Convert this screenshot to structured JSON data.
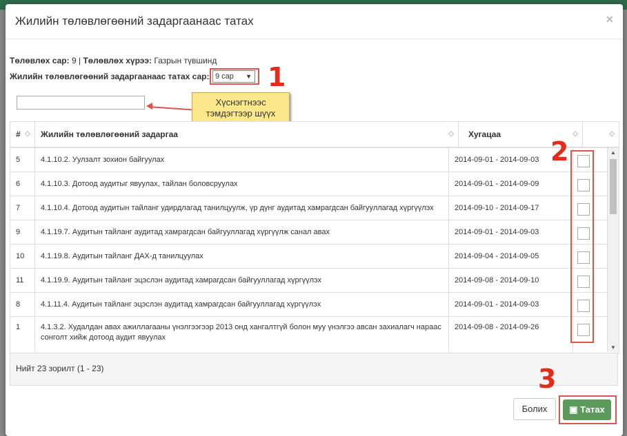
{
  "modal": {
    "title": "Жилийн төлөвлөгөөний задаргаанаас татах",
    "close": "×"
  },
  "info": {
    "month_label": "Төлөвлөх сар:",
    "month_value": "9",
    "separator": "|",
    "scope_label": "Төлөвлөх хүрээ:",
    "scope_value": "Газрын түвшинд"
  },
  "month_select": {
    "label": "Жилийн төлөвлөгөөний задаргаанаас татах сар:",
    "value": "9 сар"
  },
  "search": {
    "placeholder": ""
  },
  "callout": {
    "line1": "Хүснэгтнээс",
    "line2": "тэмдэгтээр шүүх"
  },
  "markers": {
    "m1": "1",
    "m2": "2",
    "m3": "3"
  },
  "table": {
    "headers": {
      "num": "#",
      "task": "Жилийн төлөвлөгөөний задаргаа",
      "period": "Хугацаа",
      "check": ""
    },
    "rows": [
      {
        "num": "5",
        "task": "4.1.10.2. Уулзалт зохион байгуулах",
        "period": "2014-09-01 - 2014-09-03"
      },
      {
        "num": "6",
        "task": "4.1.10.3. Дотоод аудитыг явуулах, тайлан боловсруулах",
        "period": "2014-09-01 - 2014-09-09"
      },
      {
        "num": "7",
        "task": "4.1.10.4. Дотоод аудитын тайланг удирдлагад танилцуулж, үр дүнг аудитад хамрагдсан байгууллагад хүргүүлэх",
        "period": "2014-09-10 - 2014-09-17"
      },
      {
        "num": "9",
        "task": "4.1.19.7. Аудитын тайланг аудитад хамрагдсан байгууллагад хүргүүлж санал авах",
        "period": "2014-09-01 - 2014-09-03"
      },
      {
        "num": "10",
        "task": "4.1.19.8. Аудитын тайланг ДАХ-д танилцуулах",
        "period": "2014-09-04 - 2014-09-05"
      },
      {
        "num": "11",
        "task": "4.1.19.9. Аудитын тайланг эцэслэн аудитад хамрагдсан байгууллагад хүргүүлэх",
        "period": "2014-09-08 - 2014-09-10"
      },
      {
        "num": "8",
        "task": "4.1.11.4. Аудитын тайланг эцэслэн аудитад хамрагдсан байгууллагад хүргүүлэх",
        "period": "2014-09-01 - 2014-09-03"
      },
      {
        "num": "1",
        "task": "4.1.3.2. Худалдан авах ажиллагааны үнэлгээгээр 2013 онд хангалтгүй болон муу үнэлгээ авсан захиалагч нараас сонголт хийж дотоод аудит явуулах",
        "period": "2014-09-08 - 2014-09-26"
      }
    ]
  },
  "footer": {
    "summary": "Нийт 23 зорилт (1 - 23)",
    "close_button": "Болих",
    "download_button": "Татах"
  }
}
